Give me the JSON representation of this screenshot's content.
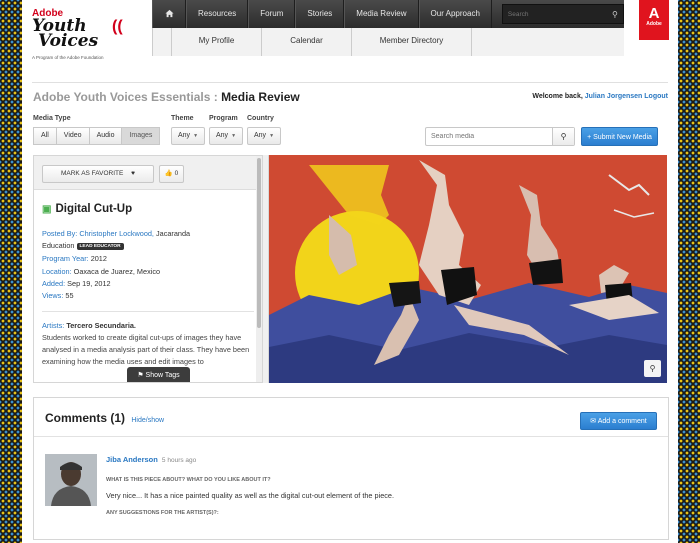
{
  "brand": {
    "adobe_text": "Adobe",
    "logo_line1": "Youth",
    "logo_line2": "Voices",
    "tagline": "A Program of the Adobe Foundation",
    "badge_text": "Adobe",
    "accent_color": "#e0141e"
  },
  "topnav": {
    "home_icon": "home-icon",
    "items": [
      "Resources",
      "Forum",
      "Stories",
      "Media Review",
      "Our Approach"
    ],
    "search_placeholder": "Search"
  },
  "subnav": {
    "items": [
      "My Profile",
      "Calendar",
      "Member Directory"
    ]
  },
  "breadcrumb": {
    "section": "Adobe Youth Voices Essentials :",
    "page": "Media Review"
  },
  "welcome": {
    "prefix": "Welcome back,",
    "user": "Julian Jorgensen",
    "logout": "Logout"
  },
  "filters": {
    "media_type_label": "Media Type",
    "media_types": [
      "All",
      "Video",
      "Audio",
      "Images"
    ],
    "active_media_type": "Images",
    "theme_label": "Theme",
    "program_label": "Program",
    "country_label": "Country",
    "dropdown_value": "Any",
    "search_placeholder": "Search media",
    "submit_label": "+ Submit New Media"
  },
  "media": {
    "favorite_label": "MARK AS FAVORITE",
    "like_count": "0",
    "title": "Digital Cut-Up",
    "posted_by_label": "Posted By:",
    "posted_by_name": "Christopher Lockwood,",
    "posted_by_org_a": "Jacaranda",
    "posted_by_org_b": "Education",
    "posted_by_badge": "LEAD EDUCATOR",
    "program_year_label": "Program Year:",
    "program_year": "2012",
    "location_label": "Location:",
    "location": "Oaxaca de Juarez, Mexico",
    "added_label": "Added:",
    "added": "Sep 19, 2012",
    "views_label": "Views:",
    "views": "55",
    "artists_label": "Artists:",
    "artists": "Tercero Secundaria.",
    "description": "Students worked to create digital cut-ups of images they have analysed in a media analysis part of their class. They have been examining how the media uses and edit images to",
    "show_tags_label": "Show Tags"
  },
  "comments": {
    "title": "Comments",
    "count": "(1)",
    "toggle": "Hide/show",
    "add_label": "Add a comment",
    "items": [
      {
        "author": "Jiba Anderson",
        "time": "5 hours ago",
        "question1": "WHAT IS THIS PIECE ABOUT? WHAT DO YOU LIKE ABOUT IT?",
        "answer1": "Very nice... It has a nice painted quality as well as the digital cut-out element of the piece.",
        "question2": "ANY SUGGESTIONS FOR THE ARTIST(S)?:"
      }
    ]
  }
}
